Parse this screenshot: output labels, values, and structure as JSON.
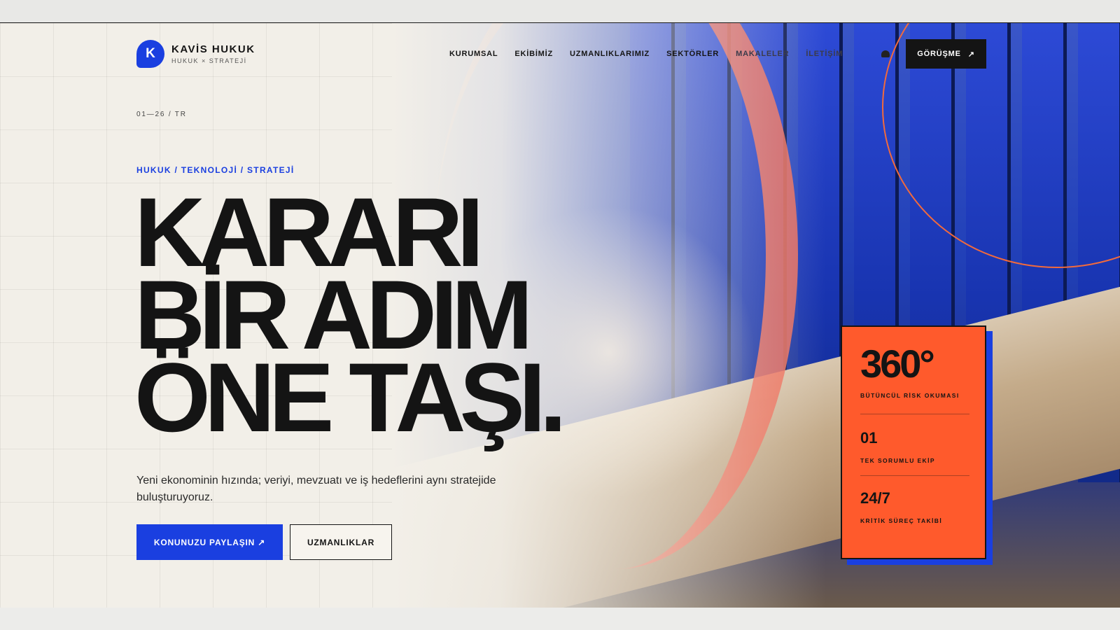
{
  "brand": {
    "logo_letter": "K",
    "name": "KAVİS HUKUK",
    "tagline": "HUKUK × STRATEJİ"
  },
  "nav": {
    "items": [
      "KURUMSAL",
      "EKİBİMİZ",
      "UZMANLIKLARIMIZ",
      "SEKTÖRLER",
      "MAKALELER",
      "İLETİŞİM"
    ],
    "cta_label": "GÖRÜŞME",
    "cta_arrow": "↗"
  },
  "hero": {
    "meta": "01—26 / TR",
    "eyebrow": "HUKUK / TEKNOLOJİ / STRATEJİ",
    "headline": [
      "KARARI",
      "BİR ADIM",
      "ÖNE TAŞI."
    ],
    "lead": "Yeni ekonominin hızında; veriyi, mevzuatı ve iş hedeflerini aynı stratejide buluşturuyoruz.",
    "primary_button": "KONUNUZU PAYLAŞIN ↗",
    "secondary_button": "UZMANLIKLAR"
  },
  "stats": [
    {
      "value": "360°",
      "label": "BÜTÜNCÜL RİSK OKUMASI"
    },
    {
      "value": "01",
      "label": "TEK SORUMLU EKİP"
    },
    {
      "value": "24/7",
      "label": "KRİTİK SÜREÇ TAKİBİ"
    }
  ],
  "colors": {
    "accent_blue": "#1a3fe0",
    "accent_orange": "#ff5a2c",
    "ink": "#141414",
    "paper": "#f2efe8"
  }
}
